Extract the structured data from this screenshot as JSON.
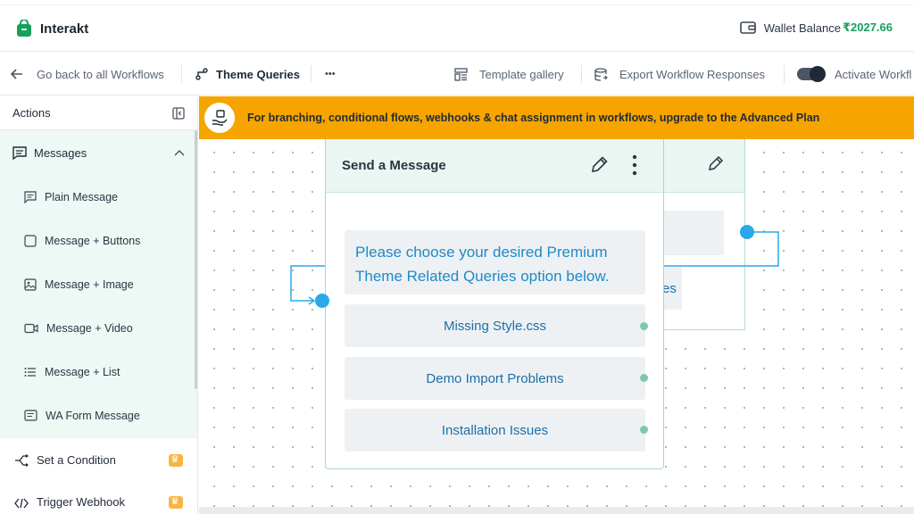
{
  "header": {
    "brand_name": "Interakt",
    "wallet_label": "Wallet Balance",
    "wallet_amount": "₹2027.66",
    "brand_color": "#17a05d"
  },
  "toolbar": {
    "back_label": "Go back to all Workflows",
    "workflow_name": "Theme Queries",
    "more_label": "•••",
    "template_gallery_label": "Template gallery",
    "export_label": "Export Workflow Responses",
    "activate_label": "Activate Workfl"
  },
  "sidebar": {
    "actions_label": "Actions",
    "messages_group": {
      "label": "Messages",
      "items": [
        {
          "label": "Plain Message",
          "icon": "chat-icon"
        },
        {
          "label": "Message + Buttons",
          "icon": "square-icon"
        },
        {
          "label": "Message + Image",
          "icon": "image-icon"
        },
        {
          "label": "Message + Video",
          "icon": "video-icon"
        },
        {
          "label": "Message + List",
          "icon": "list-icon"
        },
        {
          "label": "WA Form Message",
          "icon": "form-icon"
        }
      ]
    },
    "set_condition_label": "Set a Condition",
    "trigger_webhook_label": "Trigger Webhook"
  },
  "banner": {
    "text": "For branching, conditional flows, webhooks & chat assignment in workflows, upgrade to the Advanced Plan",
    "color": "#f6a400"
  },
  "node": {
    "title": "Send a Message",
    "message": "Please choose your desired Premium Theme Related Queries option below.",
    "options": [
      "Missing Style.css",
      "Demo Import Problems",
      "Installation Issues"
    ]
  },
  "back_node": {
    "partial_text": "es"
  },
  "colors": {
    "accent_blue": "#2aa8ea",
    "node_border": "#a9d8c8",
    "node_head_bg": "#eaf6f2"
  }
}
